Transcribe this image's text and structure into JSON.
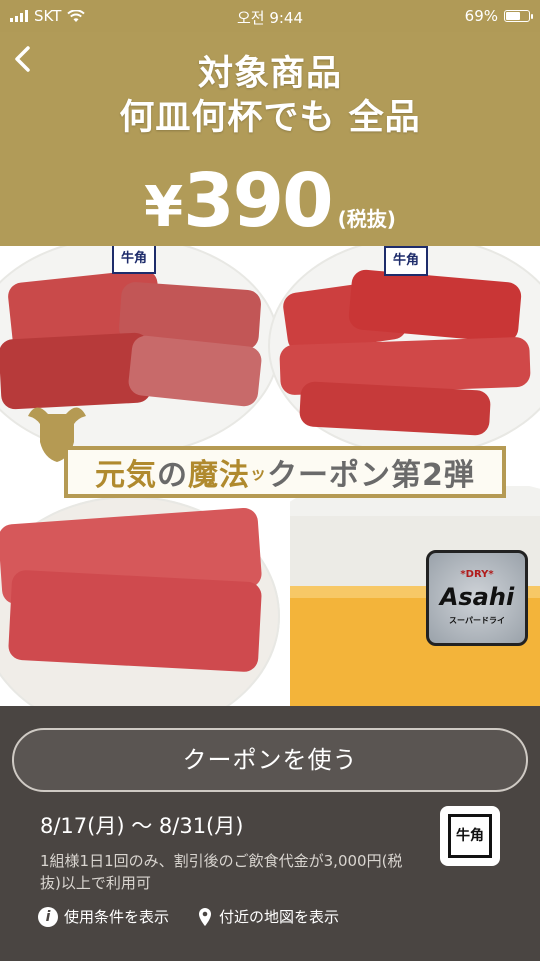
{
  "status_bar": {
    "carrier": "SKT",
    "time": "오전 9:44",
    "battery": "69%",
    "battery_level": 0.69
  },
  "header": {
    "title_line1": "対象商品",
    "title_line2": "何皿何杯でも 全品",
    "price_symbol": "¥",
    "price": "390",
    "tax_note": "(税抜)"
  },
  "promo": {
    "ribbon_part1": "元気",
    "ribbon_part2": "の",
    "ribbon_part3": "魔法",
    "ribbon_small": "ッ",
    "ribbon_part4": "クーポン第2弾",
    "plate_logo": "牛角",
    "beer_brand": "Asahi",
    "beer_dry": "*DRY*",
    "beer_super": "スーパードライ"
  },
  "coupon": {
    "use_button": "クーポンを使う",
    "period": "8/17(月) ～ 8/31(月)",
    "conditions": "1組様1日1回のみ、割引後のご飲食代金が3,000円(税抜)以上で利用可",
    "store_logo_text": "牛角",
    "link_terms": "使用条件を表示",
    "link_map": "付近の地図を表示"
  },
  "colors": {
    "gold": "#b19b58",
    "dark_panel": "#4a4542"
  }
}
